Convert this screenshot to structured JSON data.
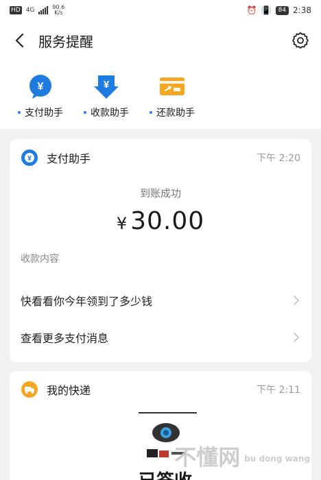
{
  "status_bar": {
    "hd": "HD",
    "network": "4G",
    "speed": "90.6\nK/s",
    "time": "2:38",
    "battery": "84"
  },
  "header": {
    "title": "服务提醒"
  },
  "shortcuts": [
    {
      "label": "支付助手"
    },
    {
      "label": "收款助手"
    },
    {
      "label": "还款助手"
    }
  ],
  "card_payment": {
    "name": "支付助手",
    "time": "下午 2:20",
    "amount_title": "到账成功",
    "currency": "¥",
    "amount": "30.00",
    "section_label": "收款内容",
    "rows": [
      {
        "label": "快看看你今年领到了多少钱"
      },
      {
        "label": "查看更多支付消息"
      }
    ]
  },
  "card_delivery": {
    "name": "我的快递",
    "time": "下午 2:11",
    "status_text": "已签收"
  },
  "watermark": {
    "text": "不懂网",
    "sub": "bu dong wang"
  }
}
